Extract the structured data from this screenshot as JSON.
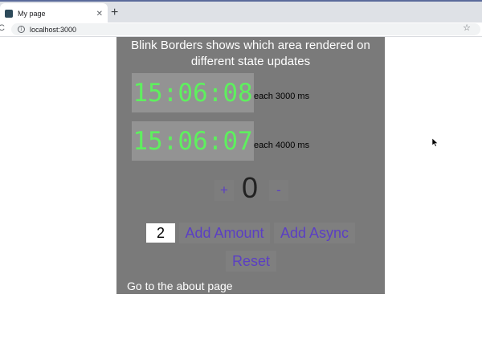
{
  "browser": {
    "tab_title": "My page",
    "tab_close": "✕",
    "new_tab": "+",
    "url": "localhost:3000",
    "reload_glyph": "C",
    "star_glyph": "☆",
    "info_glyph": "i"
  },
  "page": {
    "heading_line1": "Blink Borders shows which area rendered on",
    "heading_line2": "different state updates",
    "clocks": [
      {
        "time": "15:06:08",
        "label": "each 3000 ms"
      },
      {
        "time": "15:06:07",
        "label": "each 4000 ms"
      }
    ],
    "counter": {
      "increment_label": "+",
      "value": "0",
      "decrement_label": "-"
    },
    "amount_input_value": "2",
    "add_amount_label": "Add Amount",
    "add_async_label": "Add Async",
    "reset_label": "Reset",
    "about_link": "Go to the about page"
  },
  "colors": {
    "panel_bg": "#7a7a7a",
    "clock_bg": "#939393",
    "clock_text": "#5ef05e",
    "button_text": "#5b3fc4"
  },
  "icons": {
    "favicon": "app-favicon-icon",
    "reload": "reload-icon",
    "info": "info-icon",
    "star": "bookmark-star-icon",
    "cursor": "mouse-pointer-icon"
  }
}
